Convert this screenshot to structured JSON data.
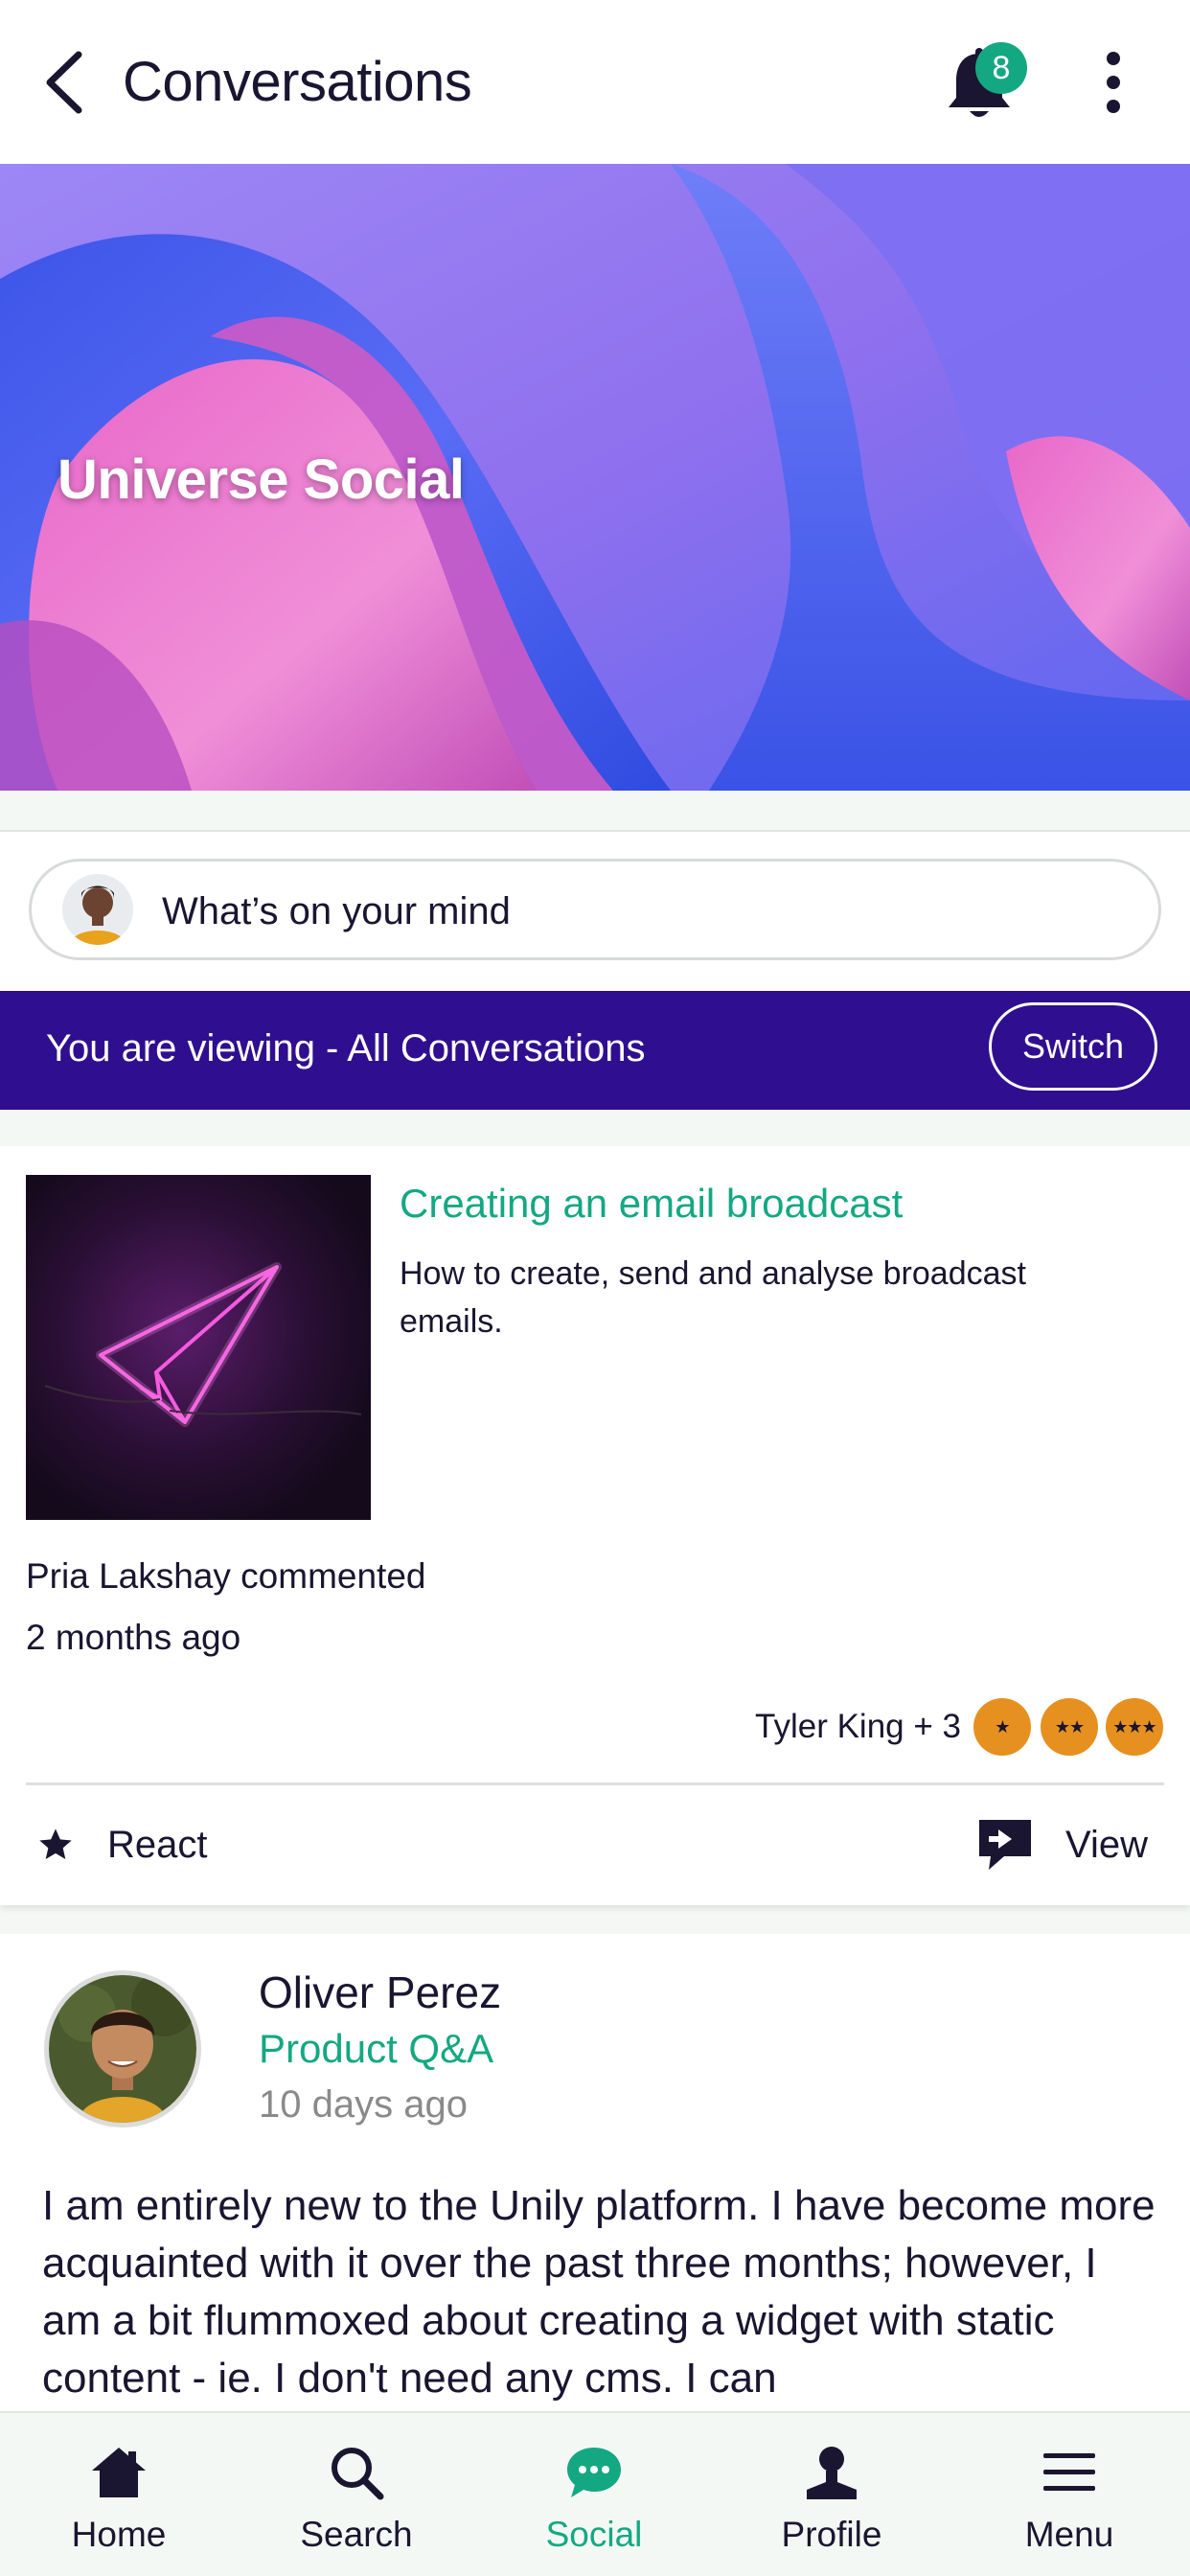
{
  "header": {
    "title": "Conversations",
    "notification_count": "8"
  },
  "hero": {
    "title": "Universe Social"
  },
  "composer": {
    "placeholder": "What’s on your mind"
  },
  "viewing_bar": {
    "text": "You are viewing - All Conversations",
    "switch_label": "Switch"
  },
  "post1": {
    "title": "Creating an email broadcast",
    "description": "How to create, send and analyse broadcast emails.",
    "activity": "Pria Lakshay commented",
    "time": "2 months ago",
    "reactors": "Tyler King + 3",
    "medals": [
      "★",
      "★★",
      "★★★"
    ],
    "react_label": "React",
    "view_label": "View"
  },
  "post2": {
    "author": "Oliver Perez",
    "group": "Product Q&A",
    "time": "10 days ago",
    "body": "I am entirely new to the Unily platform. I have become more acquainted with it over the past three months; however, I am a bit flummoxed about creating a widget with static content - ie. I don't need any cms. I can"
  },
  "tabbar": {
    "items": [
      {
        "label": "Home",
        "icon": "home-icon"
      },
      {
        "label": "Search",
        "icon": "search-icon"
      },
      {
        "label": "Social",
        "icon": "chat-bubble-icon"
      },
      {
        "label": "Profile",
        "icon": "person-icon"
      },
      {
        "label": "Menu",
        "icon": "hamburger-icon"
      }
    ],
    "active": "Social"
  },
  "colors": {
    "accent": "#14a882",
    "banner": "#2f0f8f",
    "medal": "#e6901f",
    "text": "#1a1530"
  }
}
